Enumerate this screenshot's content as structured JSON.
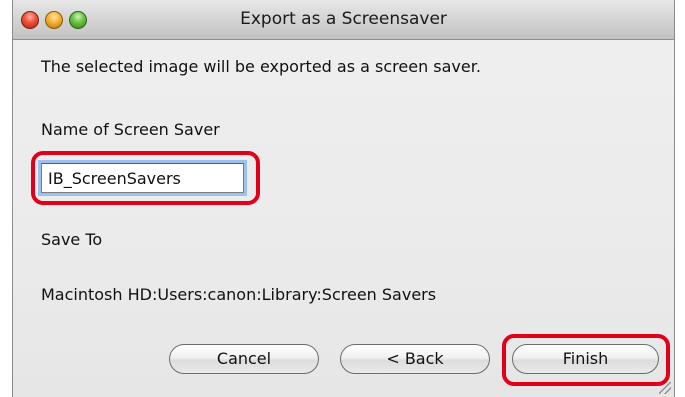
{
  "window": {
    "title": "Export as a Screensaver"
  },
  "description": "The selected image will be exported as a screen saver.",
  "name_field": {
    "label": "Name of Screen Saver",
    "value": "IB_ScreenSavers"
  },
  "save_to": {
    "label": "Save To",
    "path": "Macintosh HD:Users:canon:Library:Screen Savers"
  },
  "buttons": {
    "cancel": "Cancel",
    "back": "< Back",
    "finish": "Finish"
  },
  "colors": {
    "highlight": "#e0001a",
    "close": "#f4553f",
    "minimize": "#f9b73b",
    "zoom": "#6fc64a"
  }
}
